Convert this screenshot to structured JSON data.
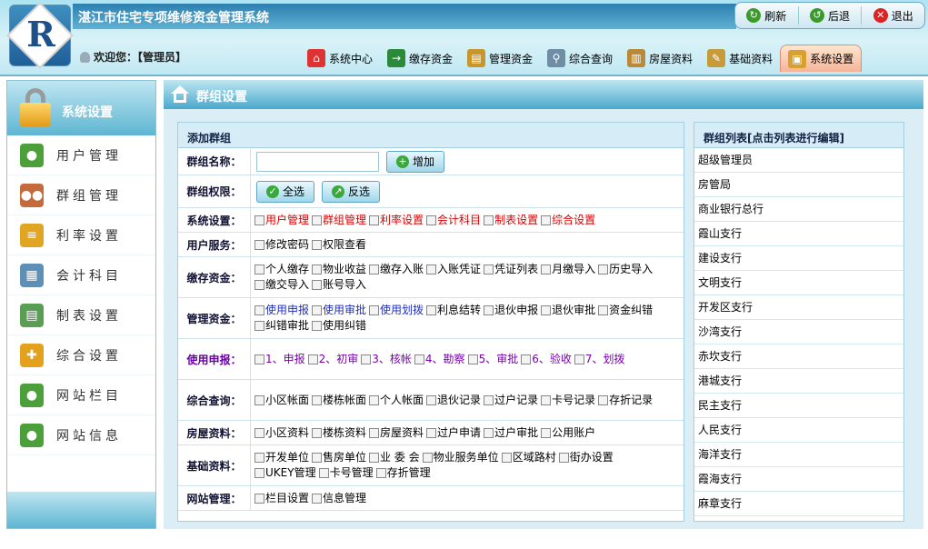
{
  "header": {
    "title": "湛江市住宅专项维修资金管理系统",
    "logo_letter": "R",
    "welcome": "欢迎您：【管理员】"
  },
  "top_buttons": [
    {
      "label": "刷新",
      "icon": "refresh-icon",
      "color": "#3a9a2a"
    },
    {
      "label": "后退",
      "icon": "back-icon",
      "color": "#3a9a2a"
    },
    {
      "label": "退出",
      "icon": "exit-icon",
      "color": "#d22"
    }
  ],
  "nav": [
    {
      "label": "系统中心",
      "icon": "home-icon",
      "color": "#d33"
    },
    {
      "label": "缴存资金",
      "icon": "deposit-icon",
      "color": "#2a8a3a"
    },
    {
      "label": "管理资金",
      "icon": "manage-funds-icon",
      "color": "#c8962a"
    },
    {
      "label": "综合查询",
      "icon": "search-icon",
      "color": "#6f8ea6"
    },
    {
      "label": "房屋资料",
      "icon": "clipboard-icon",
      "color": "#b88a3a"
    },
    {
      "label": "基础资料",
      "icon": "edit-doc-icon",
      "color": "#c79a3a"
    },
    {
      "label": "系统设置",
      "icon": "lock-icon",
      "color": "#d8a030",
      "active": true
    }
  ],
  "sidebar": {
    "title": "系统设置",
    "items": [
      {
        "label": "用户管理",
        "icon": "user-icon",
        "color": "#4ca03a"
      },
      {
        "label": "群组管理",
        "icon": "group-icon",
        "color": "#c56a3a"
      },
      {
        "label": "利率设置",
        "icon": "coins-icon",
        "color": "#e1a524"
      },
      {
        "label": "会计科目",
        "icon": "calendar-icon",
        "color": "#5d8fb7"
      },
      {
        "label": "制表设置",
        "icon": "spreadsheet-icon",
        "color": "#5a9e54"
      },
      {
        "label": "综合设置",
        "icon": "puzzle-icon",
        "color": "#e3a11c"
      },
      {
        "label": "网站栏目",
        "icon": "user-icon",
        "color": "#4ca03a"
      },
      {
        "label": "网站信息",
        "icon": "user-icon",
        "color": "#4ca03a"
      }
    ]
  },
  "content": {
    "title": "群组设置",
    "form_title": "添加群组",
    "name_label": "群组名称：",
    "name_value": "",
    "add_button": "增加",
    "perm_label": "群组权限：",
    "select_all": "全选",
    "invert": "反选",
    "sections": [
      {
        "label": "系统设置：",
        "style": "red",
        "items": [
          "用户管理",
          "群组管理",
          "利率设置",
          "会计科目",
          "制表设置",
          "综合设置"
        ]
      },
      {
        "label": "用户服务：",
        "style": "",
        "items": [
          "修改密码",
          "权限查看"
        ]
      },
      {
        "label": "缴存资金：",
        "style": "",
        "items": [
          "个人缴存",
          "物业收益",
          "缴存入账",
          "入账凭证",
          "凭证列表",
          "月缴导入",
          "历史导入",
          "缴交导入",
          "账号导入"
        ]
      },
      {
        "label": "管理资金：",
        "style": "mixed",
        "items": [
          "使用申报",
          "使用审批",
          "使用划拨",
          "利息结转",
          "退伙申报",
          "退伙审批",
          "资金纠错",
          "纠错审批",
          "使用纠错"
        ],
        "blue_count": 3
      },
      {
        "label": "使用申报：",
        "style": "purple",
        "items": [
          "1、申报",
          "2、初审",
          "3、核帐",
          "4、勘察",
          "5、审批",
          "6、验收",
          "7、划拨"
        ]
      },
      {
        "label": "综合查询：",
        "style": "",
        "items": [
          "小区帐面",
          "楼栋帐面",
          "个人帐面",
          "退伙记录",
          "过户记录",
          "卡号记录",
          "存折记录"
        ]
      },
      {
        "label": "房屋资料：",
        "style": "",
        "items": [
          "小区资料",
          "楼栋资料",
          "房屋资料",
          "过户申请",
          "过户审批",
          "公用账户"
        ]
      },
      {
        "label": "基础资料：",
        "style": "",
        "items": [
          "开发单位",
          "售房单位",
          "业 委 会",
          "物业服务单位",
          "区域路村",
          "街办设置",
          "UKEY管理",
          "卡号管理",
          "存折管理"
        ]
      },
      {
        "label": "网站管理：",
        "style": "",
        "items": [
          "栏目设置",
          "信息管理"
        ]
      }
    ],
    "list_title": "群组列表[点击列表进行编辑]",
    "groups": [
      "超级管理员",
      "房管局",
      "商业银行总行",
      "霞山支行",
      "建设支行",
      "文明支行",
      "开发区支行",
      "沙湾支行",
      "赤坎支行",
      "港城支行",
      "民主支行",
      "人民支行",
      "海洋支行",
      "霞海支行",
      "麻章支行"
    ]
  }
}
